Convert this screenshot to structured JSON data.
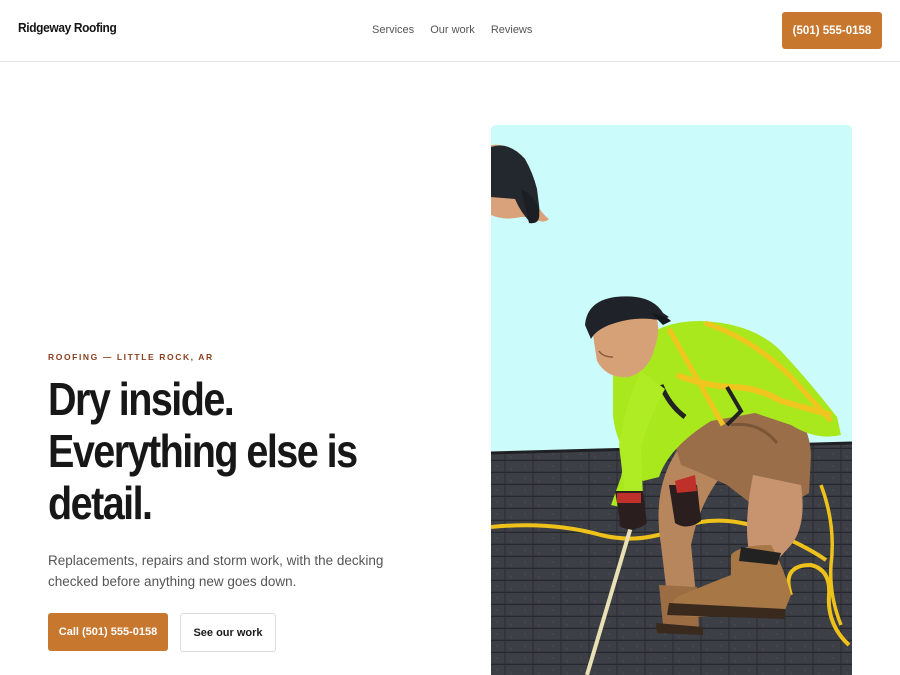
{
  "header": {
    "brand": "Ridgeway Roofing",
    "nav": [
      "Services",
      "Our work",
      "Reviews"
    ],
    "phone_button": "(501) 555-0158"
  },
  "hero": {
    "eyebrow": "ROOFING — LITTLE ROCK, AR",
    "headline_lines": [
      "Dry inside.",
      "Everything else is",
      "detail."
    ],
    "subcopy": "Replacements, repairs and storm work, with the decking checked before anything new goes down.",
    "primary_cta": "Call (501) 555-0158",
    "secondary_cta": "See our work"
  },
  "colors": {
    "accent": "#c8772f",
    "eyebrow": "#8a3f1f",
    "photo_sky": "#ccfbfc"
  }
}
